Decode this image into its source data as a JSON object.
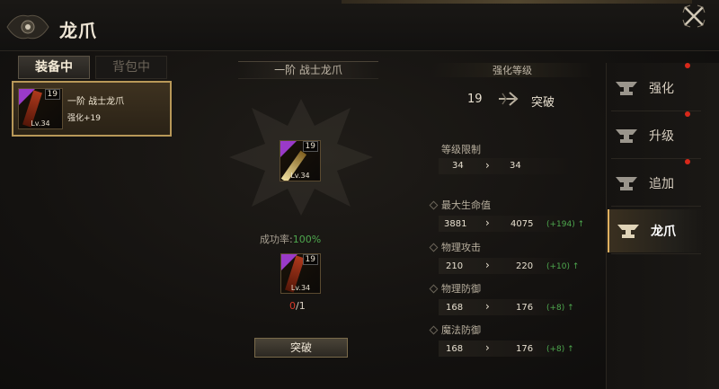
{
  "header": {
    "title": "龙爪"
  },
  "tabs": [
    {
      "label": "装备中"
    },
    {
      "label": "背包中"
    }
  ],
  "equipped_item": {
    "name": "一阶 战士龙爪",
    "enhance": "强化+19",
    "badge": "19",
    "level": "Lv.34"
  },
  "center": {
    "item_title": "一阶 战士龙爪",
    "main_icon": {
      "badge": "19",
      "level": "Lv.34"
    },
    "success_label": "成功率:",
    "success_value": "100%",
    "material_icon": {
      "badge": "19",
      "level": "Lv.34"
    },
    "material_have": "0",
    "material_need": "/1",
    "button_label": "突破"
  },
  "stats": {
    "title": "强化等级",
    "enhance_level": "19",
    "enhance_target": "突破",
    "level_limit": {
      "label": "等级限制",
      "from": "34",
      "to": "34"
    },
    "rows": [
      {
        "label": "最大生命值",
        "from": "3881",
        "to": "4075",
        "inc": "(+194)"
      },
      {
        "label": "物理攻击",
        "from": "210",
        "to": "220",
        "inc": "(+10)"
      },
      {
        "label": "物理防御",
        "from": "168",
        "to": "176",
        "inc": "(+8)"
      },
      {
        "label": "魔法防御",
        "from": "168",
        "to": "176",
        "inc": "(+8)"
      }
    ]
  },
  "nav": [
    {
      "label": "强化",
      "alert": true
    },
    {
      "label": "升级",
      "alert": true
    },
    {
      "label": "追加",
      "alert": true
    },
    {
      "label": "龙爪",
      "alert": false,
      "active": true
    }
  ],
  "colors": {
    "accent_gold": "#e0b060",
    "success_green": "#4ea84e",
    "alert_red": "#d8281a",
    "rarity_purple": "#9a3ac8"
  }
}
